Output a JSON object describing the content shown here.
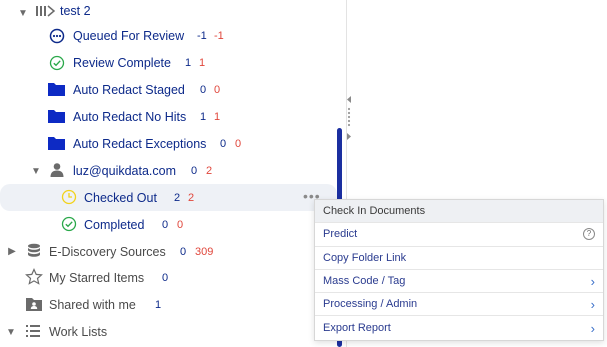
{
  "tree": {
    "root": {
      "label": "test 2"
    },
    "items": [
      {
        "id": "queued",
        "label": "Queued For Review",
        "count_a": "-1",
        "count_b": "-1",
        "icon": "more-circle-icon"
      },
      {
        "id": "review-complete",
        "label": "Review Complete",
        "count_a": "1",
        "count_b": "1",
        "icon": "check-circle-icon"
      },
      {
        "id": "ar-staged",
        "label": "Auto Redact Staged",
        "count_a": "0",
        "count_b": "0",
        "icon": "folder-icon"
      },
      {
        "id": "ar-nohits",
        "label": "Auto Redact No Hits",
        "count_a": "1",
        "count_b": "1",
        "icon": "folder-icon"
      },
      {
        "id": "ar-exc",
        "label": "Auto Redact Exceptions",
        "count_a": "0",
        "count_b": "0",
        "icon": "folder-icon"
      }
    ],
    "user": {
      "label": "luz@quikdata.com",
      "count_a": "0",
      "count_b": "2"
    },
    "user_items": [
      {
        "id": "checked-out",
        "label": "Checked Out",
        "count_a": "2",
        "count_b": "2",
        "icon": "clock-icon"
      },
      {
        "id": "completed",
        "label": "Completed",
        "count_a": "0",
        "count_b": "0",
        "icon": "check-circle-icon"
      }
    ],
    "bottom": [
      {
        "id": "ediscovery",
        "label": "E-Discovery Sources",
        "count_a": "0",
        "count_b": "309"
      },
      {
        "id": "starred",
        "label": "My Starred Items",
        "count_a": "0"
      },
      {
        "id": "shared",
        "label": "Shared with me",
        "count_a": "1"
      },
      {
        "id": "worklists",
        "label": "Work Lists"
      }
    ]
  },
  "context_menu": {
    "header": "Check In Documents",
    "items": [
      {
        "label": "Predict",
        "icon": "help-icon"
      },
      {
        "label": "Copy Folder Link",
        "icon": ""
      },
      {
        "label": "Mass Code / Tag",
        "icon": "chevron-right-icon"
      },
      {
        "label": "Processing / Admin",
        "icon": "chevron-right-icon"
      },
      {
        "label": "Export Report",
        "icon": "chevron-right-icon"
      }
    ]
  },
  "colors": {
    "accent": "#0d2a8a",
    "count_red": "#e0463b",
    "check_green": "#2aa84a",
    "clock_yellow": "#f2d21b",
    "selected_bg": "#eef1f6"
  }
}
